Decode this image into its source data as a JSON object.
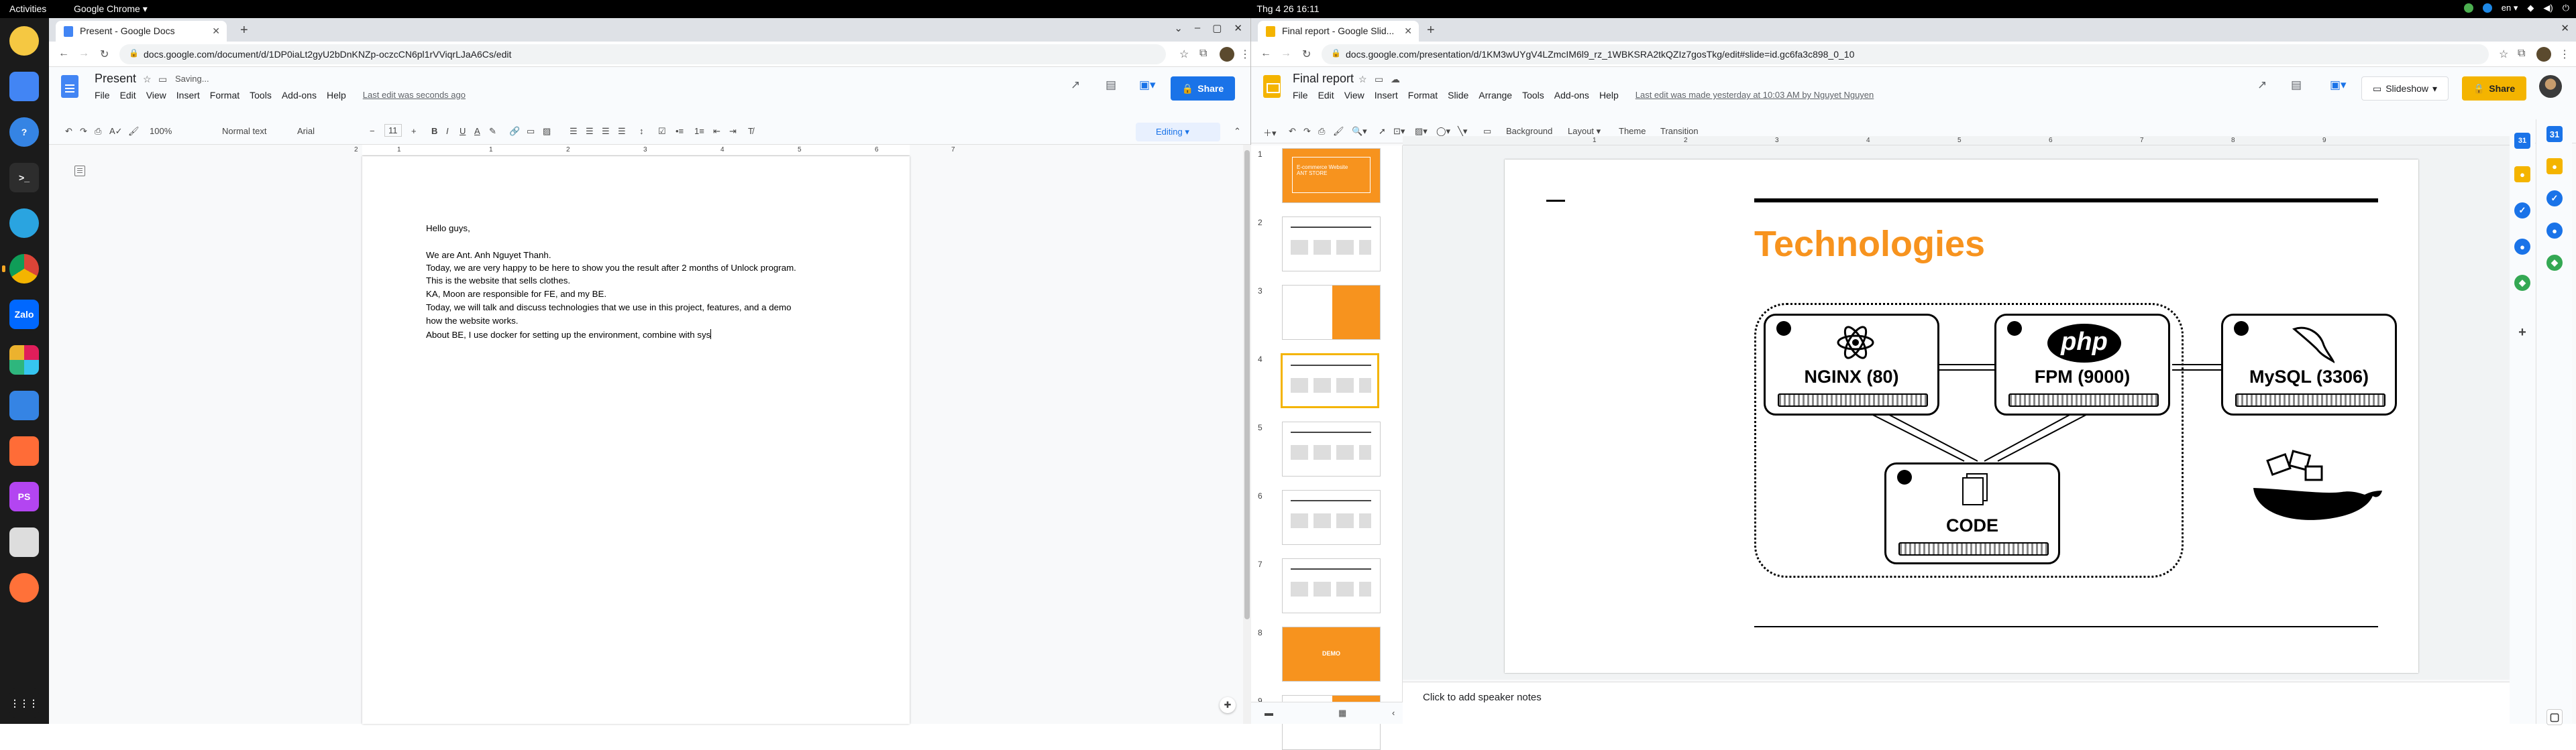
{
  "topbar": {
    "activities": "Activities",
    "app": "Google Chrome ▾",
    "clock": "Thg 4 26  16:11",
    "lang": "en ▾",
    "tray_icons": [
      "chrome-icon",
      "vpn-icon",
      "network-icon",
      "volume-icon",
      "power-icon"
    ]
  },
  "dock": {
    "items": [
      {
        "name": "rhythmbox-icon",
        "label": "",
        "color": "#f5c842"
      },
      {
        "name": "docs-icon",
        "label": "",
        "color": "#4285f4"
      },
      {
        "name": "help-icon",
        "label": "?",
        "color": "#3584e4"
      },
      {
        "name": "terminal-icon",
        "label": ">_",
        "color": "#2d2d2d"
      },
      {
        "name": "telegram-icon",
        "label": "",
        "color": "#2aa4e0"
      },
      {
        "name": "chrome-icon",
        "label": "",
        "color": "#de5246"
      },
      {
        "name": "zalo-icon",
        "label": "Zalo",
        "color": "#0068ff"
      },
      {
        "name": "slack-icon",
        "label": "",
        "color": "#ffffff"
      },
      {
        "name": "screenshot-icon",
        "label": "",
        "color": "#3584e4"
      },
      {
        "name": "postman-icon",
        "label": "",
        "color": "#ff6c37"
      },
      {
        "name": "phpstorm-icon",
        "label": "PS",
        "color": "#b345f1"
      },
      {
        "name": "text-editor-icon",
        "label": "",
        "color": "#ddd"
      },
      {
        "name": "firefox-icon",
        "label": "",
        "color": "#ff7139"
      },
      {
        "name": "show-apps-icon",
        "label": "⋮⋮⋮",
        "color": "#1b1b1b"
      }
    ]
  },
  "left": {
    "tab_title": "Present - Google Docs",
    "url": "docs.google.com/document/d/1DP0iaLt2gyU2bDnKNZp-oczcCN6pl1rVViqrLJaA6Cs/edit",
    "doc_title": "Present",
    "status": "Saving...",
    "menu": [
      "File",
      "Edit",
      "View",
      "Insert",
      "Format",
      "Tools",
      "Add-ons",
      "Help"
    ],
    "last_edit": "Last edit was seconds ago",
    "share": "Share",
    "toolbar": {
      "zoom": "100%",
      "style": "Normal text",
      "font": "Arial",
      "size": "11",
      "mode": "Editing"
    },
    "ruler_numbers": [
      "2",
      "1",
      "1",
      "2",
      "3",
      "4",
      "5",
      "6",
      "7"
    ],
    "body_lines": [
      "Hello guys,",
      "",
      "We are Ant. Anh Nguyet Thanh.",
      "Today, we are very happy to be here to show you the result after 2 months of Unlock program.",
      "This is the website that sells clothes.",
      "KA, Moon are responsible for FE, and my BE.",
      "Today, we will talk and discuss technologies that we use in this project, features, and a demo",
      "how the website works.",
      "About BE, I use docker for setting up the environment, combine with sys"
    ]
  },
  "right": {
    "tab_title": "Final report - Google Slid...",
    "url": "docs.google.com/presentation/d/1KM3wUYgV4LZmcIM6l9_rz_1WBKSRA2tkQZIz7gosTkg/edit#slide=id.gc6fa3c898_0_10",
    "doc_title": "Final report",
    "menu": [
      "File",
      "Edit",
      "View",
      "Insert",
      "Format",
      "Slide",
      "Arrange",
      "Tools",
      "Add-ons",
      "Help"
    ],
    "last_edit": "Last edit was made yesterday at 10:03 AM by Nguyet Nguyen",
    "slideshow": "Slideshow",
    "share": "Share",
    "toolbar": {
      "background": "Background",
      "layout": "Layout ▾",
      "theme": "Theme",
      "transition": "Transition"
    },
    "ruler_numbers": [
      "1",
      "2",
      "3",
      "4",
      "5",
      "6",
      "7",
      "8",
      "9"
    ],
    "slide_numbers": [
      "1",
      "2",
      "3",
      "4",
      "5",
      "6",
      "7",
      "8",
      "9"
    ],
    "thumb1_title": "E-commerce Website\nANT STORE",
    "thumb8_title": "DEMO",
    "slide": {
      "title": "Technologies",
      "accent": "#f7931e",
      "nodes": [
        {
          "name": "nginx-node",
          "label": "NGINX (80)"
        },
        {
          "name": "fpm-node",
          "label": "FPM (9000)"
        },
        {
          "name": "mysql-node",
          "label": "MySQL (3306)"
        },
        {
          "name": "code-node",
          "label": "CODE"
        }
      ],
      "php_logo": "php"
    },
    "notes": "Click to add speaker notes"
  }
}
